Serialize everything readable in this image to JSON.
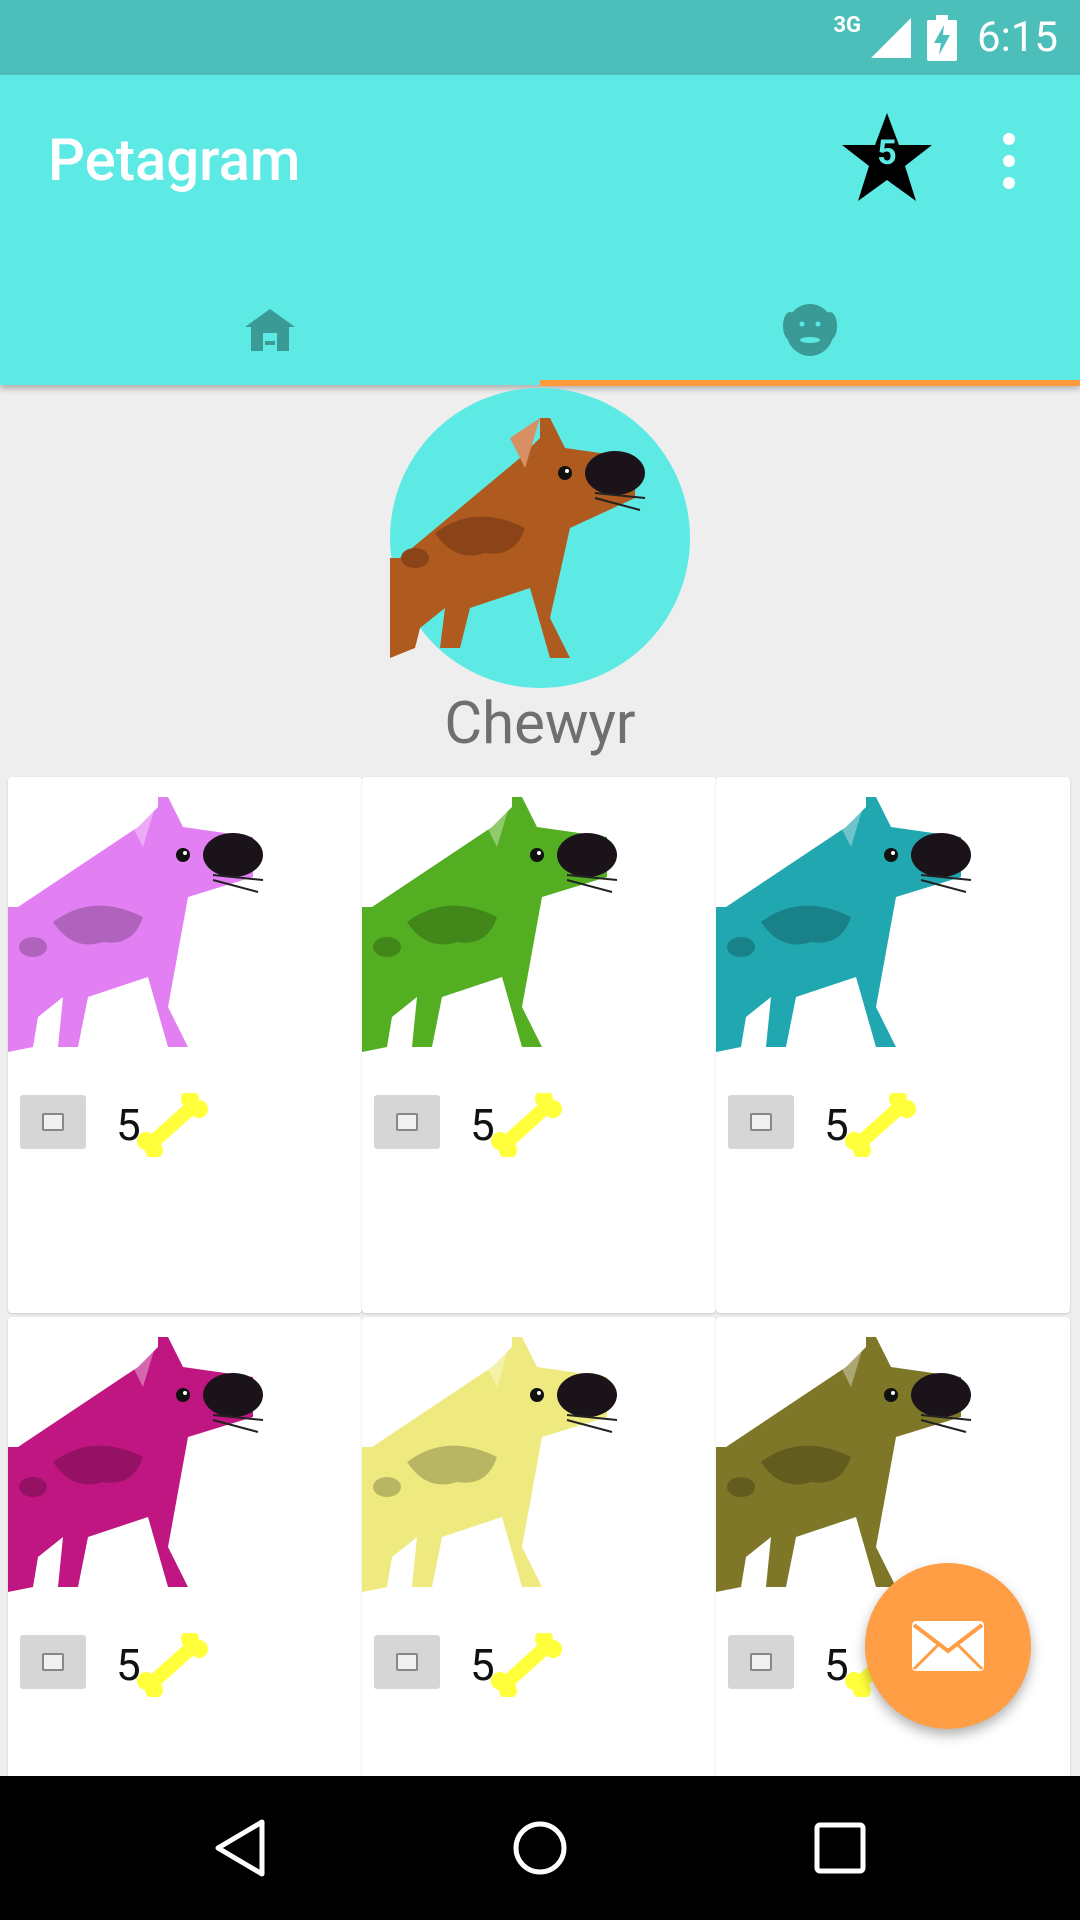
{
  "status_bar": {
    "network": "3G",
    "time": "6:15"
  },
  "app_bar": {
    "title": "Petagram",
    "favorites_count": "5"
  },
  "tabs": [
    {
      "label": "home"
    },
    {
      "label": "profile"
    }
  ],
  "profile": {
    "name": "Chewyr"
  },
  "colors": {
    "primary": "#5eeae4",
    "status_bar": "#4dbfba",
    "accent": "#ff9a3c",
    "bone": "#ffff3c"
  },
  "photos": [
    {
      "color": "#e27ff2",
      "likes": "5"
    },
    {
      "color": "#54ae22",
      "likes": "5"
    },
    {
      "color": "#20a7b0",
      "likes": "5"
    },
    {
      "color": "#bf1681",
      "likes": "5"
    },
    {
      "color": "#eeea7f",
      "likes": "5"
    },
    {
      "color": "#7e7728",
      "likes": "5"
    }
  ]
}
